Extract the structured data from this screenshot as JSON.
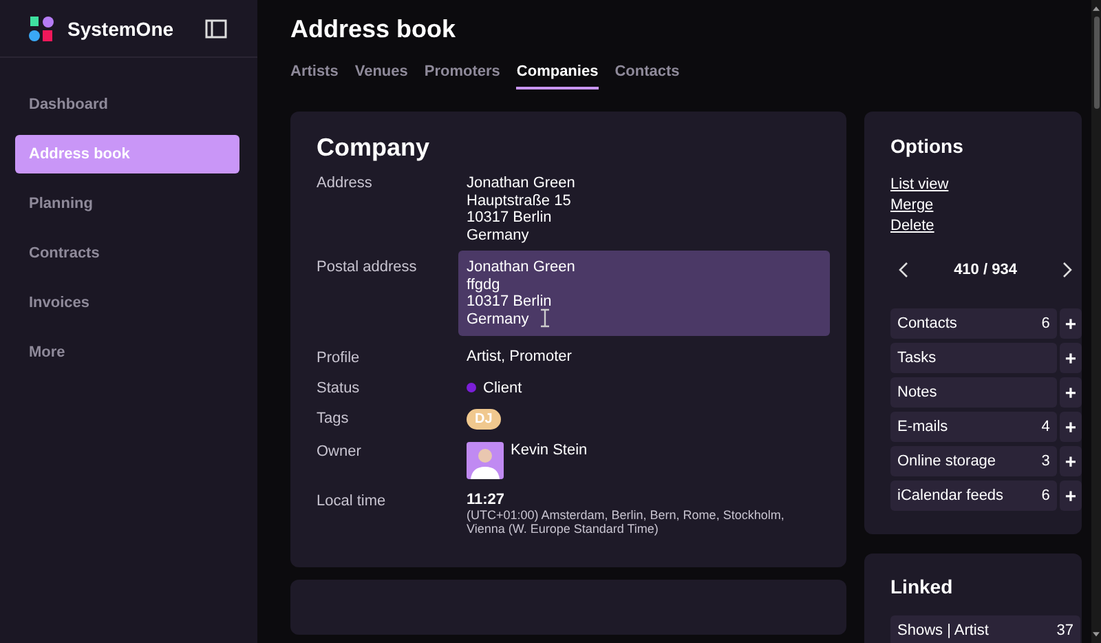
{
  "app": {
    "name": "SystemOne"
  },
  "sidebar": {
    "items": [
      {
        "label": "Dashboard",
        "selected": false
      },
      {
        "label": "Address book",
        "selected": true
      },
      {
        "label": "Planning",
        "selected": false
      },
      {
        "label": "Contracts",
        "selected": false
      },
      {
        "label": "Invoices",
        "selected": false
      },
      {
        "label": "More",
        "selected": false
      }
    ]
  },
  "page": {
    "title": "Address book"
  },
  "tabs": [
    {
      "label": "Artists",
      "selected": false
    },
    {
      "label": "Venues",
      "selected": false
    },
    {
      "label": "Promoters",
      "selected": false
    },
    {
      "label": "Companies",
      "selected": true
    },
    {
      "label": "Contacts",
      "selected": false
    }
  ],
  "company": {
    "title": "Company",
    "fields": [
      {
        "kind": "lines",
        "label": "Address",
        "lines": [
          "Jonathan Green",
          "Hauptstraße 15",
          "10317 Berlin",
          "Germany"
        ],
        "highlighted": false
      },
      {
        "kind": "lines",
        "label": "Postal address",
        "lines": [
          "Jonathan Green",
          "ffgdg",
          "10317 Berlin",
          "Germany"
        ],
        "highlighted": true
      },
      {
        "kind": "text",
        "label": "Profile",
        "value": "Artist, Promoter"
      },
      {
        "kind": "status",
        "label": "Status",
        "value": "Client",
        "color": "#7b1fd8"
      },
      {
        "kind": "tag",
        "label": "Tags",
        "value": "DJ",
        "color": "#f0c88e"
      },
      {
        "kind": "owner",
        "label": "Owner",
        "value": "Kevin Stein"
      },
      {
        "kind": "time",
        "label": "Local time",
        "value": "11:27",
        "note": "(UTC+01:00) Amsterdam, Berlin, Bern, Rome, Stockholm, Vienna (W. Europe Standard Time)"
      }
    ]
  },
  "options": {
    "title": "Options",
    "links": [
      "List view",
      "Merge",
      "Delete"
    ],
    "pager": "410 / 934",
    "rows": [
      {
        "label": "Contacts",
        "count": "6"
      },
      {
        "label": "Tasks"
      },
      {
        "label": "Notes"
      },
      {
        "label": "E-mails",
        "count": "4"
      },
      {
        "label": "Online storage",
        "count": "3"
      },
      {
        "label": "iCalendar feeds",
        "count": "6"
      }
    ],
    "add": "+"
  },
  "linked": {
    "title": "Linked",
    "rows": [
      {
        "label": "Shows | Artist",
        "count": "37"
      }
    ]
  }
}
